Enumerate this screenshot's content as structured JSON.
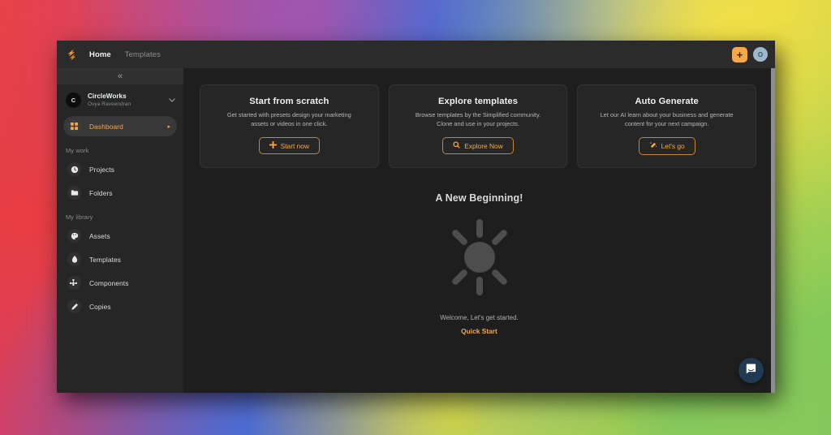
{
  "topbar": {
    "logo_icon": "simplified-lightning-logo",
    "nav": [
      {
        "label": "Home",
        "active": true
      },
      {
        "label": "Templates",
        "active": false
      }
    ],
    "plus_label": "+",
    "plus_icon": "plus-icon",
    "avatar_initial": "O",
    "accent_color": "#f5a94b"
  },
  "sidebar": {
    "collapse_icon": "«",
    "workspace": {
      "initial": "C",
      "name": "CircleWorks",
      "user": "Ovya Raveendran",
      "chevron": "⌄"
    },
    "primary": [
      {
        "label": "Dashboard",
        "icon": "grid-icon",
        "active": true,
        "caret": "▸"
      }
    ],
    "sections": [
      {
        "title": "My work",
        "items": [
          {
            "label": "Projects",
            "icon": "clock-icon"
          },
          {
            "label": "Folders",
            "icon": "folder-icon"
          }
        ]
      },
      {
        "title": "My library",
        "items": [
          {
            "label": "Assets",
            "icon": "palette-icon"
          },
          {
            "label": "Templates",
            "icon": "droplet-icon"
          },
          {
            "label": "Components",
            "icon": "puzzle-icon"
          },
          {
            "label": "Copies",
            "icon": "pencil-icon"
          }
        ]
      }
    ]
  },
  "main": {
    "cards": [
      {
        "title": "Start from scratch",
        "desc": "Get started with presets design your marketing assets or videos in one click.",
        "button": "Start now",
        "button_icon": "plus-icon"
      },
      {
        "title": "Explore templates",
        "desc": "Browse templates by the Simplified community. Clone and use in your projects.",
        "button": "Explore Now",
        "button_icon": "search-icon"
      },
      {
        "title": "Auto Generate",
        "desc": "Let our AI learn about your business and generate content for your next campaign.",
        "button": "Let's go",
        "button_icon": "magic-wand-icon"
      }
    ],
    "empty_state": {
      "title": "A New Beginning!",
      "illustration_icon": "sun-burst-icon",
      "subtitle": "Welcome, Let's get started.",
      "link": "Quick Start"
    },
    "chat_icon": "chat-bubble-icon"
  }
}
